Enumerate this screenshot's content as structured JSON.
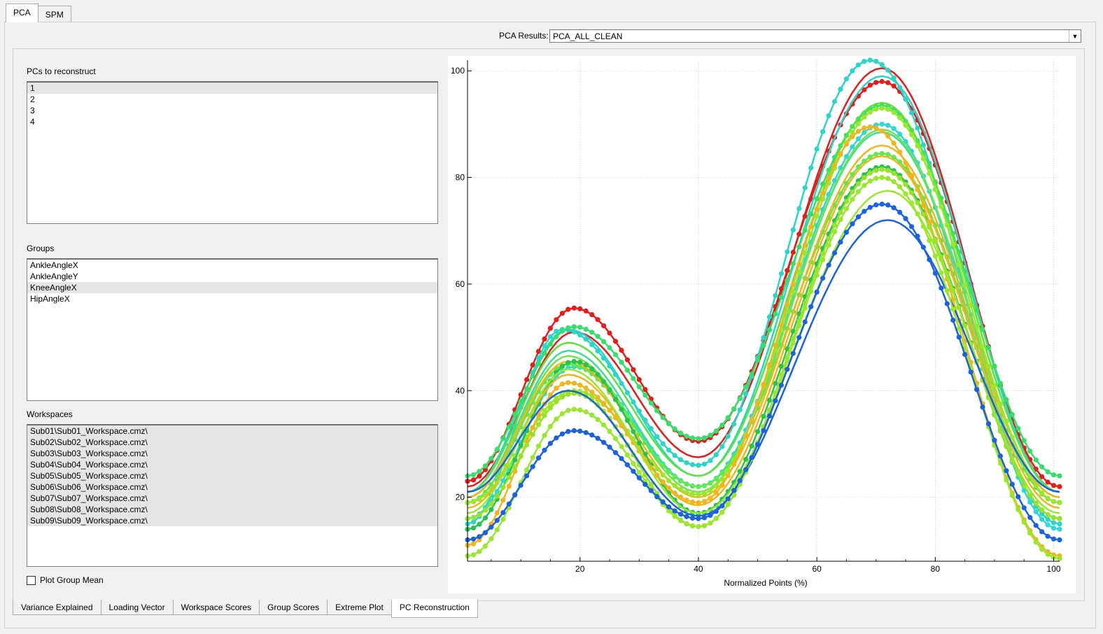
{
  "top_tabs": [
    {
      "label": "PCA",
      "active": true
    },
    {
      "label": "SPM",
      "active": false
    }
  ],
  "pca_results": {
    "label": "PCA Results:",
    "value": "PCA_ALL_CLEAN"
  },
  "pcs": {
    "label": "PCs to reconstruct",
    "items": [
      "1",
      "2",
      "3",
      "4"
    ],
    "selected_index": 0
  },
  "groups": {
    "label": "Groups",
    "items": [
      "AnkleAngleX",
      "AnkleAngleY",
      "KneeAngleX",
      "HipAngleX"
    ],
    "selected_index": 2
  },
  "workspaces": {
    "label": "Workspaces",
    "items": [
      "Sub01\\Sub01_Workspace.cmz\\",
      "Sub02\\Sub02_Workspace.cmz\\",
      "Sub03\\Sub03_Workspace.cmz\\",
      "Sub04\\Sub04_Workspace.cmz\\",
      "Sub05\\Sub05_Workspace.cmz\\",
      "Sub06\\Sub06_Workspace.cmz\\",
      "Sub07\\Sub07_Workspace.cmz\\",
      "Sub08\\Sub08_Workspace.cmz\\",
      "Sub09\\Sub09_Workspace.cmz\\"
    ],
    "all_selected": true
  },
  "plot_group_mean": {
    "label": "Plot Group Mean",
    "checked": false
  },
  "bottom_tabs": [
    {
      "label": "Variance Explained",
      "active": false
    },
    {
      "label": "Loading Vector",
      "active": false
    },
    {
      "label": "Workspace Scores",
      "active": false
    },
    {
      "label": "Group Scores",
      "active": false
    },
    {
      "label": "Extreme Plot",
      "active": false
    },
    {
      "label": "PC Reconstruction",
      "active": true
    }
  ],
  "chart_data": {
    "type": "line",
    "title": "",
    "xlabel": "Normalized Points (%)",
    "ylabel": "",
    "xlim": [
      1,
      101
    ],
    "ylim": [
      8,
      102
    ],
    "x_ticks": [
      20,
      40,
      60,
      80,
      100
    ],
    "y_ticks": [
      20,
      40,
      60,
      80,
      100
    ],
    "grid": true,
    "legend": "none",
    "series": [
      {
        "color": "#e81b1b",
        "markers": true,
        "x": [
          1,
          19,
          40,
          71,
          101
        ],
        "y": [
          23,
          55.5,
          30.5,
          98.0,
          22.0
        ]
      },
      {
        "color": "#e81b1b",
        "markers": false,
        "x": [
          1,
          19,
          40,
          71,
          101
        ],
        "y": [
          22,
          51.0,
          27.5,
          100.5,
          21.0
        ]
      },
      {
        "color": "#2ad6c8",
        "markers": true,
        "x": [
          1,
          17,
          40,
          69,
          101
        ],
        "y": [
          15,
          51.5,
          26.0,
          102.0,
          15.0
        ]
      },
      {
        "color": "#2ad6c8",
        "markers": false,
        "x": [
          1,
          18,
          40,
          71,
          101
        ],
        "y": [
          21,
          51.5,
          24.0,
          99.0,
          21.0
        ]
      },
      {
        "color": "#34e06a",
        "markers": true,
        "x": [
          1,
          19,
          40,
          71,
          101
        ],
        "y": [
          24,
          52.0,
          31.0,
          93.5,
          24.0
        ]
      },
      {
        "color": "#5be33a",
        "markers": false,
        "x": [
          1,
          18,
          40,
          71,
          101
        ],
        "y": [
          21,
          49.0,
          24.0,
          94.0,
          21.0
        ]
      },
      {
        "color": "#3fdc9a",
        "markers": false,
        "x": [
          1,
          18,
          40,
          71,
          101
        ],
        "y": [
          20,
          47.5,
          22.0,
          88.5,
          20.0
        ]
      },
      {
        "color": "#2fd8d8",
        "markers": true,
        "x": [
          1,
          19,
          40,
          71,
          101
        ],
        "y": [
          16,
          44.5,
          22.0,
          90.0,
          14.0
        ]
      },
      {
        "color": "#74e34a",
        "markers": false,
        "x": [
          1,
          18,
          40,
          71,
          101
        ],
        "y": [
          20,
          46.5,
          21.0,
          89.0,
          20.0
        ]
      },
      {
        "color": "#5fe84f",
        "markers": true,
        "x": [
          1,
          18,
          40,
          71,
          101
        ],
        "y": [
          19,
          45.0,
          22.0,
          84.5,
          19.0
        ]
      },
      {
        "color": "#f2b51c",
        "markers": false,
        "x": [
          1,
          18,
          40,
          71,
          101
        ],
        "y": [
          20,
          45.5,
          20.0,
          86.0,
          20.0
        ]
      },
      {
        "color": "#9ae82b",
        "markers": true,
        "x": [
          1,
          19,
          40,
          71,
          101
        ],
        "y": [
          19,
          40.0,
          20.5,
          93.0,
          19.0
        ]
      },
      {
        "color": "#26c44f",
        "markers": true,
        "x": [
          1,
          19,
          40,
          71,
          101
        ],
        "y": [
          14,
          45.5,
          17.0,
          82.0,
          16.0
        ]
      },
      {
        "color": "#f2b51c",
        "markers": true,
        "x": [
          1,
          18,
          40,
          69,
          101
        ],
        "y": [
          11,
          41.5,
          19.0,
          89.5,
          9.0
        ]
      },
      {
        "color": "#f2b51c",
        "markers": false,
        "x": [
          1,
          18,
          40,
          71,
          101
        ],
        "y": [
          18,
          43.0,
          18.5,
          84.0,
          18.0
        ]
      },
      {
        "color": "#98e32a",
        "markers": true,
        "x": [
          1,
          19,
          40,
          71,
          101
        ],
        "y": [
          16,
          39.5,
          14.5,
          81.5,
          16.0
        ]
      },
      {
        "color": "#9ae82b",
        "markers": false,
        "x": [
          1,
          18,
          40,
          72,
          101
        ],
        "y": [
          17,
          44.0,
          17.0,
          77.5,
          17.0
        ]
      },
      {
        "color": "#1a62e0",
        "markers": false,
        "x": [
          1,
          18,
          40,
          72,
          101
        ],
        "y": [
          21,
          40.0,
          16.5,
          72.0,
          21.0
        ]
      },
      {
        "color": "#9ae82b",
        "markers": true,
        "x": [
          1,
          19,
          40,
          71,
          101
        ],
        "y": [
          9,
          36.5,
          14.5,
          80.0,
          8.5
        ]
      },
      {
        "color": "#1a62e0",
        "markers": true,
        "x": [
          1,
          19,
          40,
          71,
          101
        ],
        "y": [
          12,
          32.5,
          16.0,
          75.0,
          12.0
        ]
      }
    ]
  }
}
